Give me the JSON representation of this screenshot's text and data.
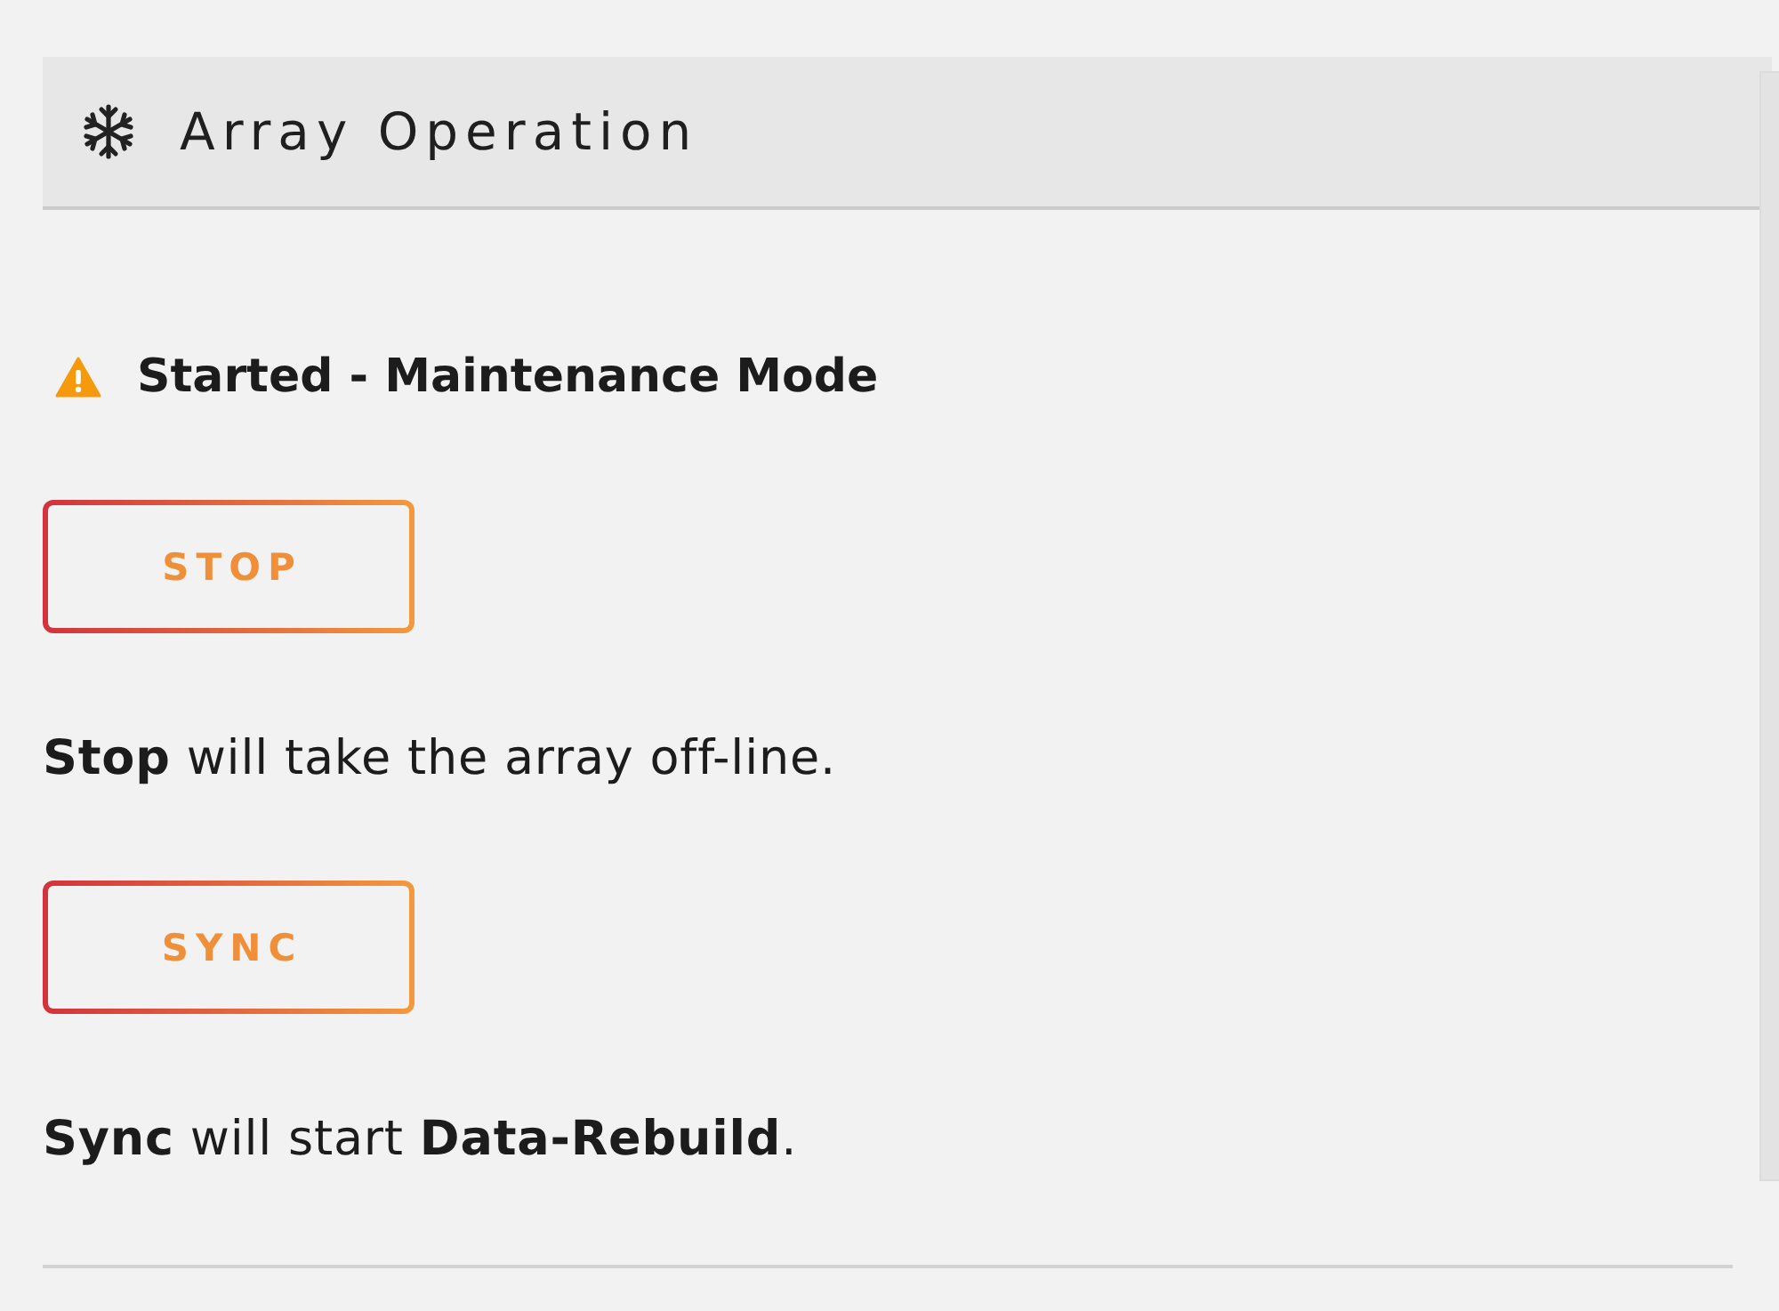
{
  "header": {
    "title": "Array Operation"
  },
  "status": {
    "kind": "warning",
    "text": "Started - Maintenance Mode"
  },
  "actions": [
    {
      "button": "STOP",
      "description": "**Stop** will take the array off-line."
    },
    {
      "button": "SYNC",
      "description": "**Sync** will start **Data-Rebuild**."
    }
  ]
}
